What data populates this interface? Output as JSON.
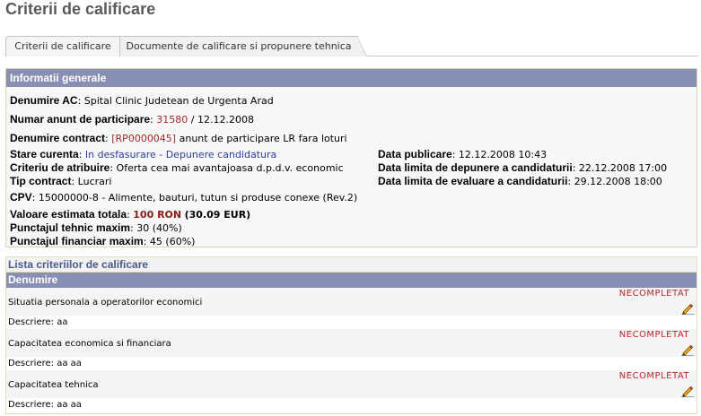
{
  "page": {
    "title": "Criterii de calificare"
  },
  "tabs": [
    {
      "label": "Criterii de calificare"
    },
    {
      "label": "Documente de calificare si propunere tehnica"
    }
  ],
  "info": {
    "header": "Informatii generale",
    "denumire_ac_label": "Denumire AC",
    "denumire_ac_value": ": Spital Clinic Judetean de Urgenta Arad",
    "numar_anunt_label": "Numar anunt de participare",
    "numar_anunt_sep": ":",
    "numar_anunt_number": "31580",
    "numar_anunt_date": "/ 12.12.2008",
    "denumire_contract_label": "Denumire contract",
    "denumire_contract_sep": ":",
    "denumire_contract_code": "[RP0000045]",
    "denumire_contract_value": "anunt de participare LR fara loturi",
    "stare_label": "Stare curenta",
    "stare_sep": ":",
    "stare_value": "In desfasurare - Depunere candidatura",
    "criteriu_label": "Criteriu de atribuire",
    "criteriu_value": ": Oferta cea mai avantajoasa d.p.d.v. economic",
    "tip_label": "Tip contract",
    "tip_value": ": Lucrari",
    "cpv_label": "CPV",
    "cpv_value": ":  15000000-8 - Alimente, bauturi, tutun si produse conexe (Rev.2)",
    "valoare_label": "Valoare estimata totala",
    "valoare_sep": ":",
    "valoare_ron": "100 RON",
    "valoare_eur": "(30.09 EUR)",
    "tehnic_label": "Punctajul tehnic maxim",
    "tehnic_value": ": 30 (40%)",
    "financiar_label": "Punctajul financiar maxim",
    "financiar_value": ": 45 (60%)",
    "publicare_label": "Data publicare",
    "publicare_value": ": 12.12.2008 10:43",
    "depunere_label": "Data limita de depunere a candidaturii",
    "depunere_value": ": 22.12.2008 17:00",
    "evaluare_label": "Data limita de evaluare a candidaturii",
    "evaluare_value": ": 29.12.2008 18:00"
  },
  "criteria": {
    "title": "Lista criteriilor de calificare",
    "column": "Denumire",
    "items": [
      {
        "name": "Situatia personala a operatorilor economici",
        "status": "NECOMPLETAT",
        "desc": "Descriere: aa"
      },
      {
        "name": "Capacitatea economica si financiara",
        "status": "NECOMPLETAT",
        "desc": "Descriere: aa aa"
      },
      {
        "name": "Capacitatea tehnica",
        "status": "NECOMPLETAT",
        "desc": "Descriere: aa aa"
      }
    ]
  },
  "icons": {
    "edit": "pencil-icon"
  },
  "colors": {
    "header": "#8790b4",
    "status": "#b3282d",
    "accent_red": "#a0282a",
    "link_blue": "#2a3f9a"
  }
}
